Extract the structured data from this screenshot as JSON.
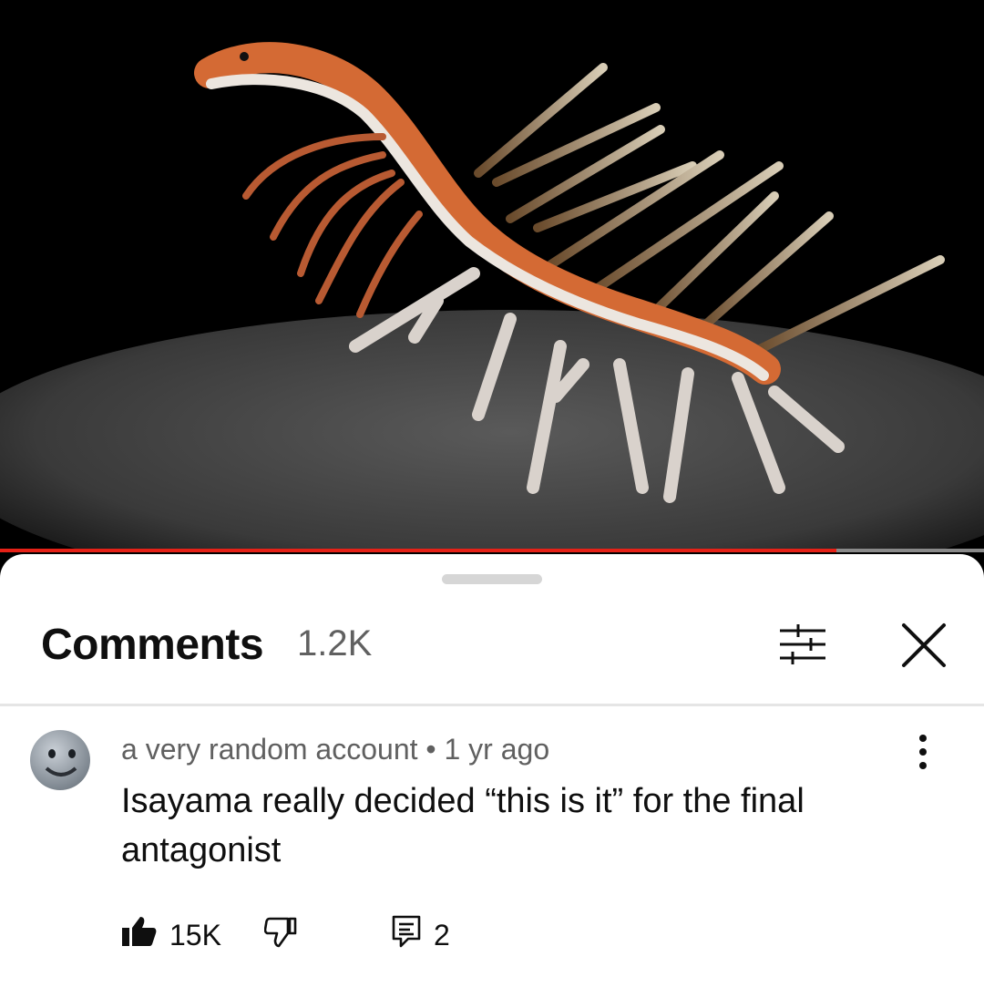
{
  "video": {
    "progress_fraction": 0.85,
    "progress_color": "#e62117"
  },
  "comments_header": {
    "title": "Comments",
    "count": "1.2K",
    "filter_icon": "filter-sliders-icon",
    "close_icon": "close-icon"
  },
  "comment": {
    "author": "a very random account",
    "separator": "•",
    "time": "1 yr ago",
    "text": "Isayama really decided “this is it” for the final antagonist",
    "likes": "15K",
    "replies": "2",
    "avatar_icon": "avatar-icon",
    "more_icon": "more-vert-icon"
  }
}
